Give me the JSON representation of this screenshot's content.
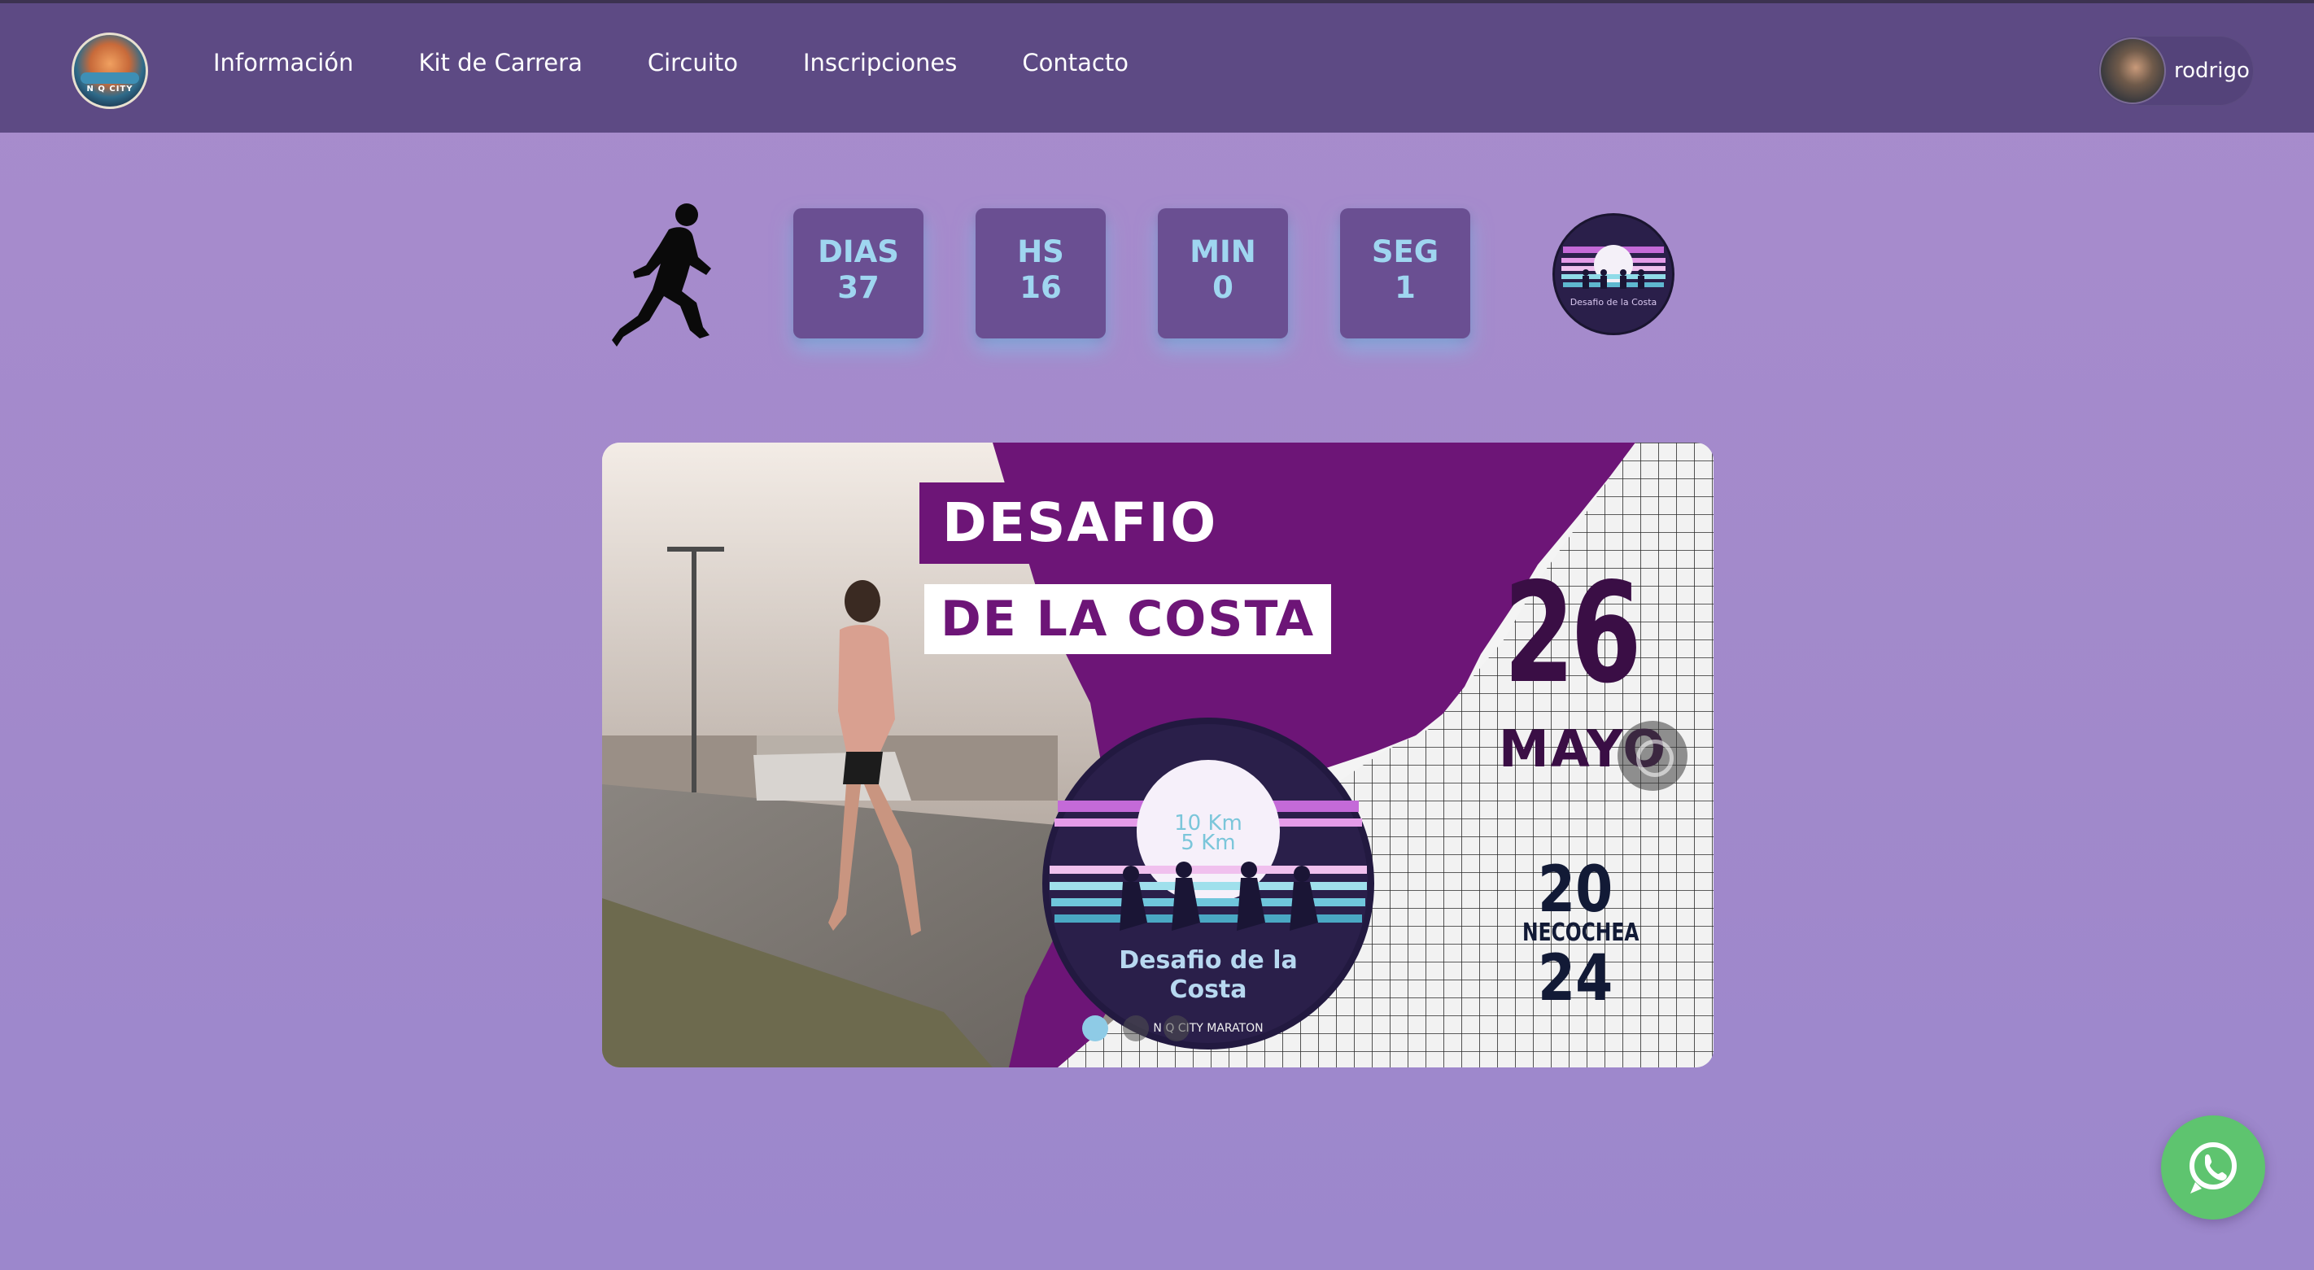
{
  "nav": {
    "logo_text": "N Q CITY",
    "links": [
      "Información",
      "Kit de Carrera",
      "Circuito",
      "Inscripciones",
      "Contacto"
    ],
    "user": {
      "name": "rodrigo"
    }
  },
  "countdown": {
    "items": [
      {
        "label": "DIAS",
        "value": "37"
      },
      {
        "label": "HS",
        "value": "16"
      },
      {
        "label": "MIN",
        "value": "0"
      },
      {
        "label": "SEG",
        "value": "1"
      }
    ],
    "accent_color": "#9fd6f0"
  },
  "event_badge": {
    "distances": "10 Km 5 Km",
    "name": "Desafio de la Costa",
    "brand": "N Q CITY MARATON"
  },
  "banner": {
    "title_line1": "DESAFIO",
    "title_line2": "DE LA COSTA",
    "day": "26",
    "month": "MAYO",
    "year_top": "20",
    "city": "NECOCHEA",
    "year_bottom": "24",
    "badge_distances_1": "10 Km",
    "badge_distances_2": "5 Km",
    "badge_name_1": "Desafio de la",
    "badge_name_2": "Costa",
    "badge_brand": "N Q CITY MARATON",
    "slides": 3,
    "active_slide": 1,
    "brand_color": "#6d1577"
  },
  "whatsapp": {
    "icon": "whatsapp-icon",
    "color": "#5ec46f"
  }
}
